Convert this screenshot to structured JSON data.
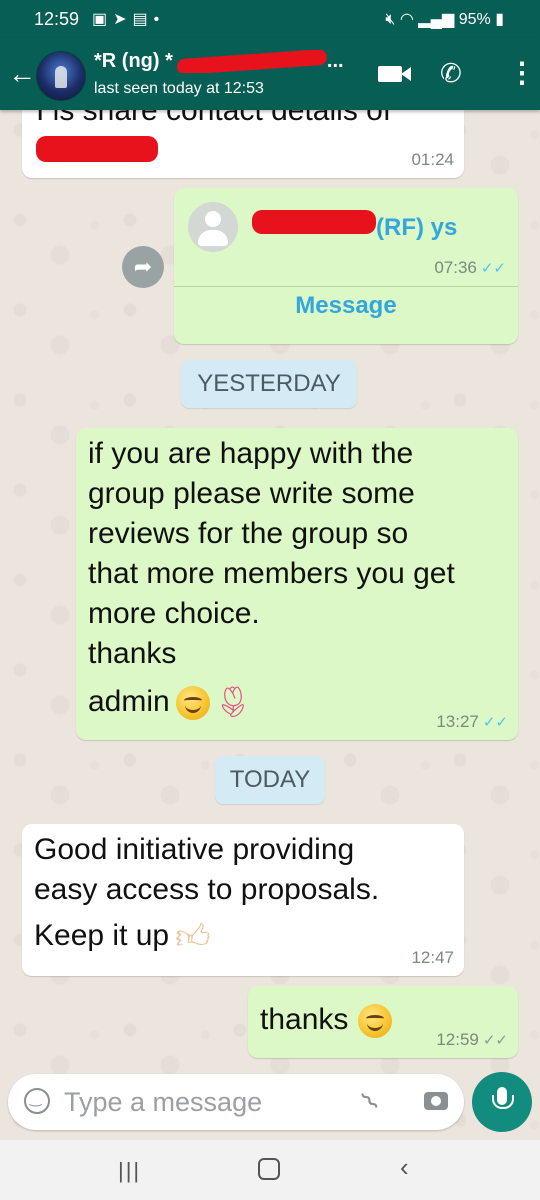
{
  "status_bar": {
    "time": "12:59",
    "left_icons": [
      "gallery-icon",
      "send-icon",
      "message-icon",
      "dot-icon"
    ],
    "battery": "95%",
    "right_icons": [
      "mute-icon",
      "wifi-icon",
      "signal-icon",
      "battery-icon"
    ]
  },
  "header": {
    "contact_name": "*R (ng) *",
    "contact_name_suffix": "...",
    "last_seen": "last seen today at 12:53"
  },
  "messages": [
    {
      "kind": "incoming",
      "text": "I is share contact details of",
      "time": "01:24"
    },
    {
      "kind": "outgoing-contact",
      "contact_label": "(RF) ys",
      "time": "07:36",
      "action": "Message"
    },
    {
      "kind": "date",
      "text": "YESTERDAY"
    },
    {
      "kind": "outgoing",
      "lines": [
        "if you are happy with the",
        "group please write some",
        "reviews for the group so",
        "that more members you get",
        "more choice.",
        "thanks",
        "admin"
      ],
      "time": "13:27"
    },
    {
      "kind": "date",
      "text": "TODAY"
    },
    {
      "kind": "incoming",
      "lines": [
        "Good initiative providing",
        "easy access to proposals.",
        "Keep it up"
      ],
      "time": "12:47"
    },
    {
      "kind": "outgoing",
      "text": "thanks",
      "time": "12:59"
    }
  ],
  "composer": {
    "placeholder": "Type a message"
  },
  "colors": {
    "header": "#075e54",
    "outgoing_bubble": "#dcf8c6",
    "incoming_bubble": "#ffffff",
    "date_chip": "#d4eaf4",
    "link": "#34a6dd",
    "mic_button": "#128c7e",
    "read_tick": "#4fc3f7"
  }
}
